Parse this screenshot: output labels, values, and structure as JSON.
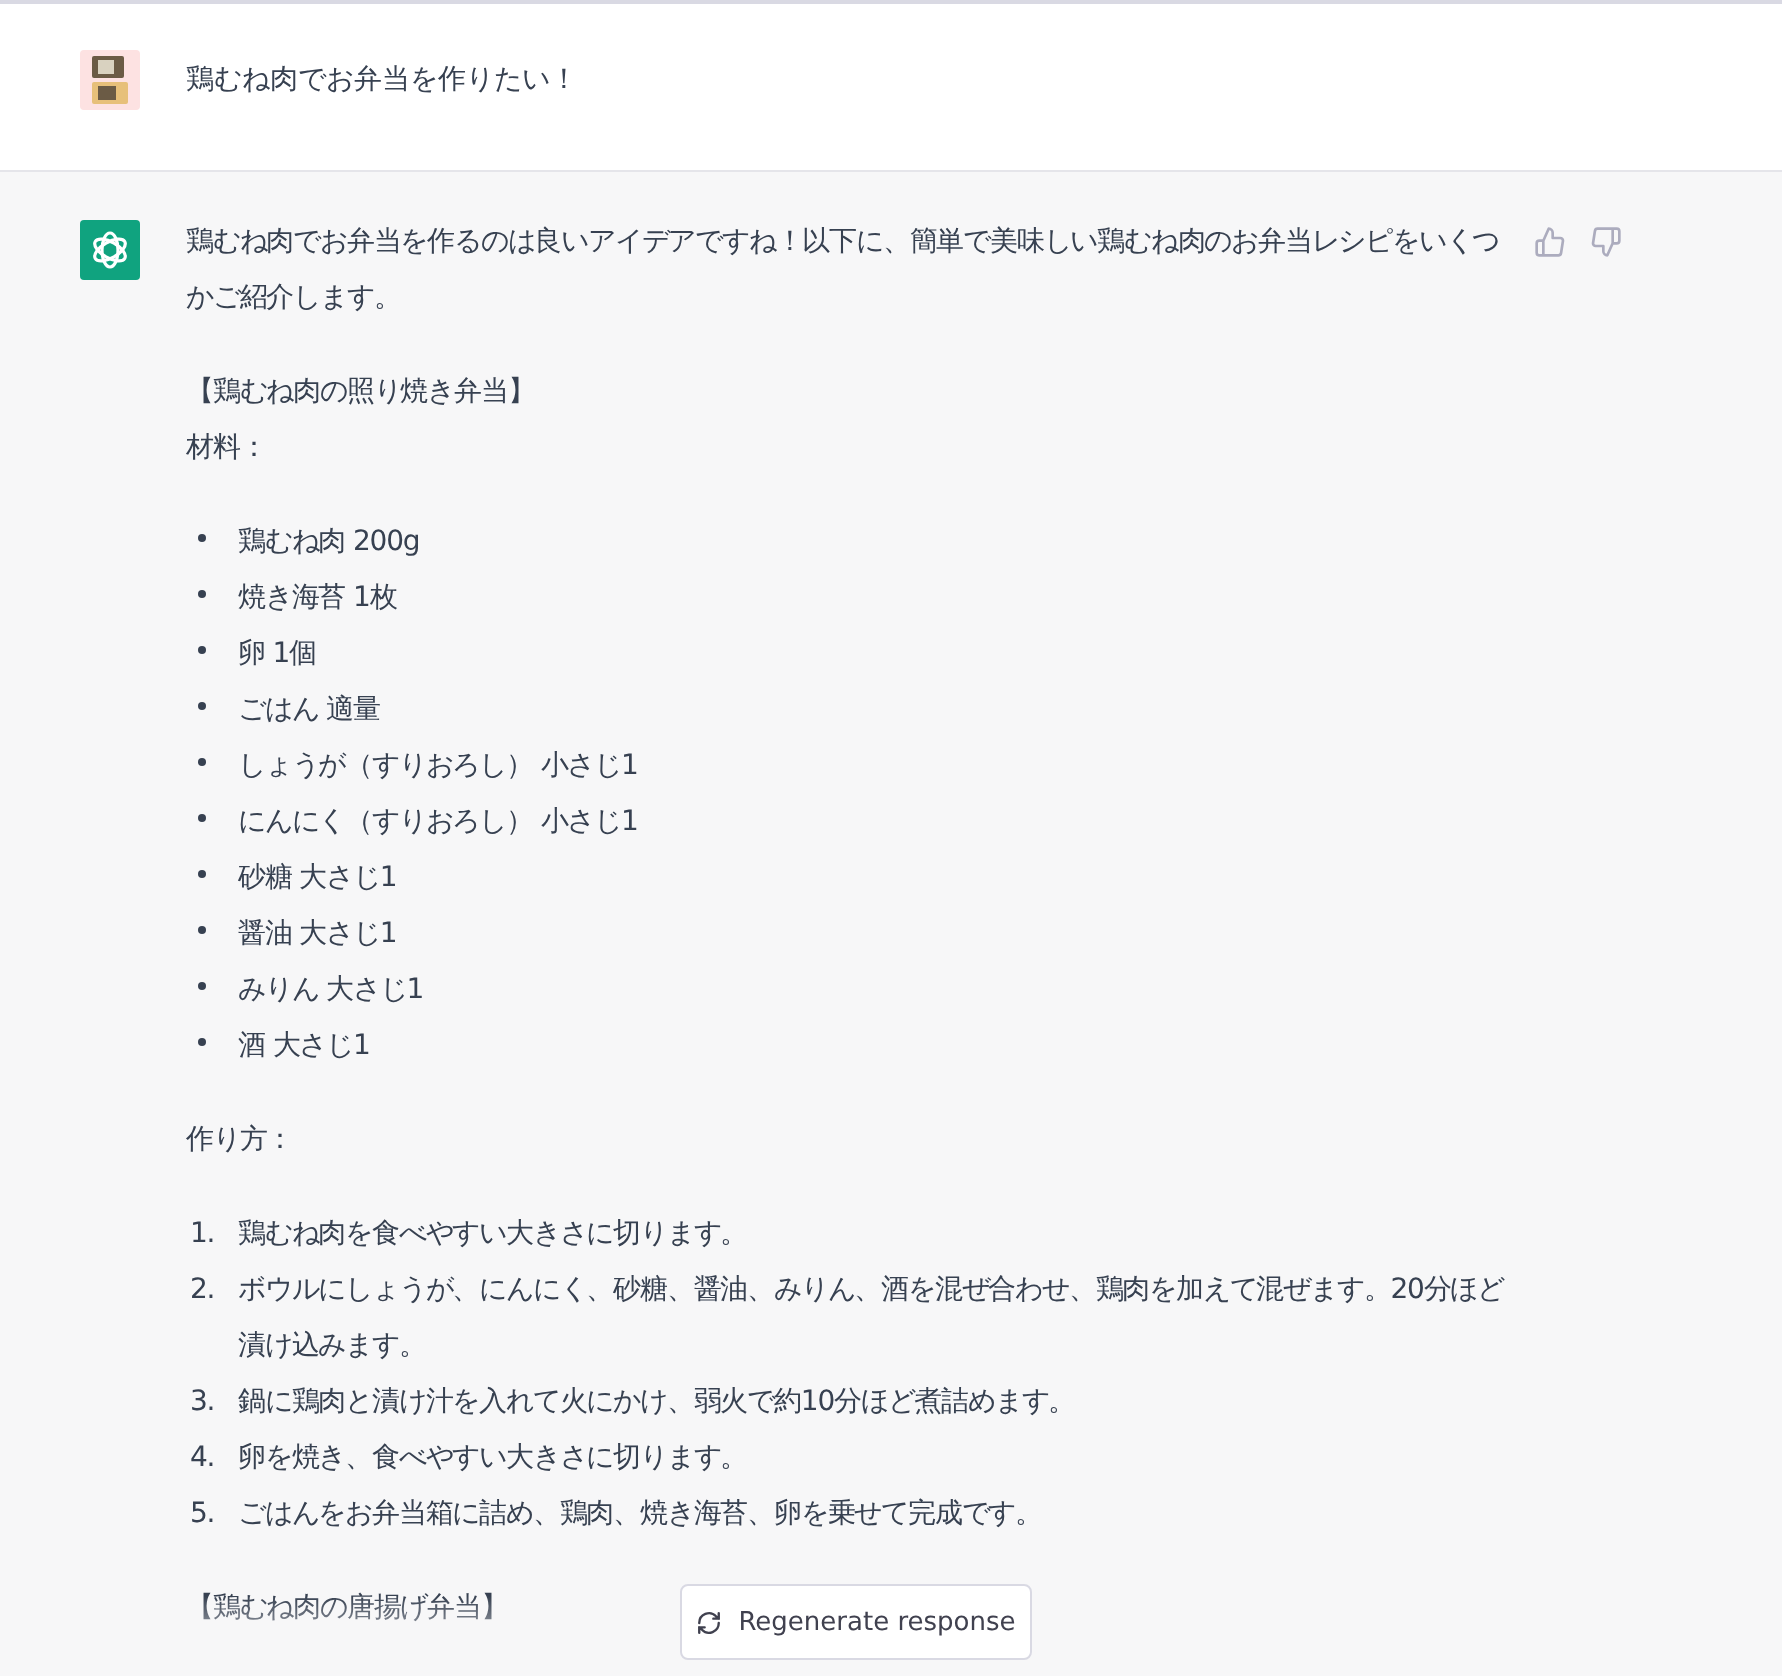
{
  "user_message": {
    "text": "鶏むね肉でお弁当を作りたい！"
  },
  "assistant_message": {
    "intro": "鶏むね肉でお弁当を作るのは良いアイデアですね！以下に、簡単で美味しい鶏むね肉のお弁当レシピをいくつかご紹介します。",
    "blocks": [
      {
        "kind": "heading",
        "text": "【鶏むね肉の照り焼き弁当】"
      },
      {
        "kind": "label",
        "text": "材料："
      },
      {
        "kind": "bullets",
        "items": [
          "鶏むね肉 200g",
          "焼き海苔 1枚",
          "卵 1個",
          "ごはん 適量",
          "しょうが（すりおろし） 小さじ1",
          "にんにく（すりおろし） 小さじ1",
          "砂糖 大さじ1",
          "醤油 大さじ1",
          "みりん 大さじ1",
          "酒 大さじ1"
        ]
      },
      {
        "kind": "label",
        "text": "作り方："
      },
      {
        "kind": "steps",
        "items": [
          {
            "number": "1.",
            "text": "鶏むね肉を食べやすい大きさに切ります。"
          },
          {
            "number": "2.",
            "text": "ボウルにしょうが、にんにく、砂糖、醤油、みりん、酒を混ぜ合わせ、鶏肉を加えて混ぜます。20分ほど漬け込みます。"
          },
          {
            "number": "3.",
            "text": "鍋に鶏肉と漬け汁を入れて火にかけ、弱火で約10分ほど煮詰めます。"
          },
          {
            "number": "4.",
            "text": "卵を焼き、食べやすい大きさに切ります。"
          },
          {
            "number": "5.",
            "text": "ごはんをお弁当箱に詰め、鶏肉、焼き海苔、卵を乗せて完成です。"
          }
        ]
      },
      {
        "kind": "heading",
        "text": "【鶏むね肉の唐揚げ弁当】"
      }
    ]
  },
  "regenerate_button": {
    "label": "Regenerate response"
  }
}
